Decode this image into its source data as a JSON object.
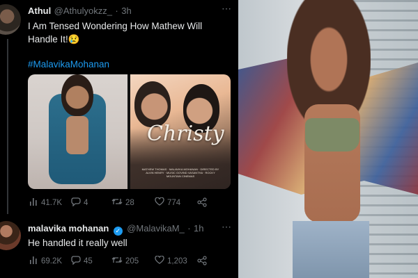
{
  "tweet": {
    "author_name": "Athul",
    "author_handle": "@Athulyokzz_",
    "timestamp": "3h",
    "text": "I Am Tensed Wondering How Mathew Will Handle It!😢",
    "hashtag": "#MalavikaMohanan",
    "media": {
      "poster_title": "Christy",
      "poster_credits": "MATHEW THOMAS · MALAVIKA MOHANAN · DIRECTED BY ALVIN HENRY · MUSIC GOVIND VASANTHA · ROCKY MOUNTAIN CINEMAS"
    },
    "stats": {
      "views": "41.7K",
      "replies": "4",
      "retweets": "28",
      "likes": "774"
    }
  },
  "reply": {
    "author_name": "malavika mohanan",
    "author_handle": "@MalavikaM_",
    "timestamp": "1h",
    "text": "He handled it really well",
    "stats": {
      "views": "69.2K",
      "replies": "45",
      "retweets": "205",
      "likes": "1,203"
    }
  },
  "colors": {
    "background": "#000000",
    "text": "#e7e9ea",
    "muted": "#71767b",
    "link": "#1d9bf0"
  },
  "icons": [
    "more-icon",
    "analytics-icon",
    "reply-icon",
    "retweet-icon",
    "like-icon",
    "share-icon",
    "verified-icon"
  ]
}
